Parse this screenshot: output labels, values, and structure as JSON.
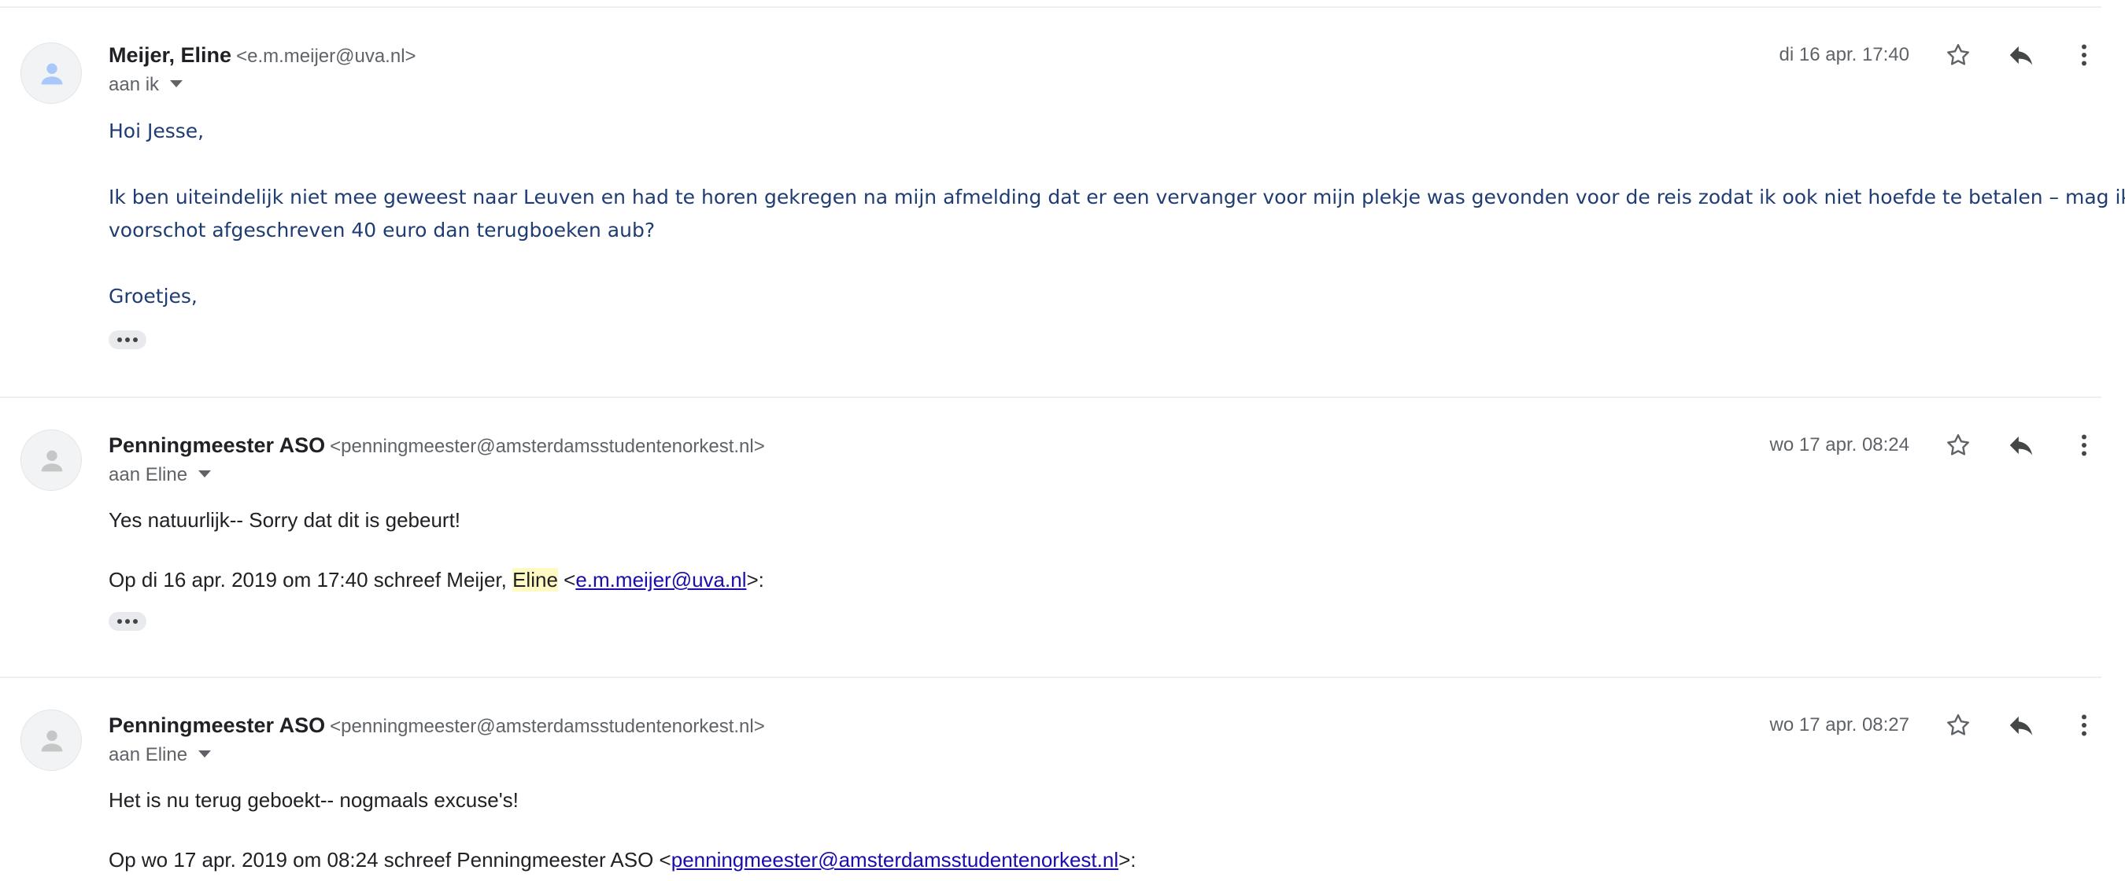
{
  "messages": [
    {
      "sender_name": "Meijer, Eline",
      "sender_email": "<e.m.meijer@uva.nl>",
      "recipient": "aan ik",
      "date": "di 16 apr. 17:40",
      "body": [
        "Hoi Jesse,",
        "Ik ben uiteindelijk niet mee geweest naar Leuven en had te horen gekregen na mijn afmelding dat er een vervanger voor mijn plekje was gevonden voor de reis zodat ik ook niet hoefde te betalen – mag ik de als",
        "voorschot afgeschreven 40 euro dan terugboeken aub?",
        "Groetjes,"
      ]
    },
    {
      "sender_name": "Penningmeester ASO",
      "sender_email": "<penningmeester@amsterdamsstudentenorkest.nl>",
      "recipient": "aan Eline",
      "date": "wo 17 apr. 08:24",
      "body": [
        "Yes natuurlijk-- Sorry dat dit is gebeurt!"
      ],
      "quote": {
        "prefix": "Op di 16 apr. 2019 om 17:40 schreef Meijer,",
        "highlight": "Eline",
        "open": "<",
        "link": "e.m.meijer@uva.nl",
        "close": ">:"
      }
    },
    {
      "sender_name": "Penningmeester ASO",
      "sender_email": "<penningmeester@amsterdamsstudentenorkest.nl>",
      "recipient": "aan Eline",
      "date": "wo 17 apr. 08:27",
      "body": [
        "Het is nu terug geboekt-- nogmaals excuse's!"
      ],
      "quote": {
        "prefix": "Op wo 17 apr. 2019 om 08:24 schreef Penningmeester ASO <",
        "link": "penningmeester@amsterdamsstudentenorkest.nl",
        "close": ">:"
      }
    }
  ],
  "icons": {
    "star": "star-outline-icon",
    "reply": "reply-icon",
    "more": "more-vert-icon",
    "avatar": "person-icon",
    "expand": "more-horiz-icon"
  },
  "colors": {
    "avatar_blue": "#a8c7fa",
    "avatar_gray": "#c4c7c5",
    "link": "#1a0dab",
    "body_blue": "#1f3c73"
  }
}
